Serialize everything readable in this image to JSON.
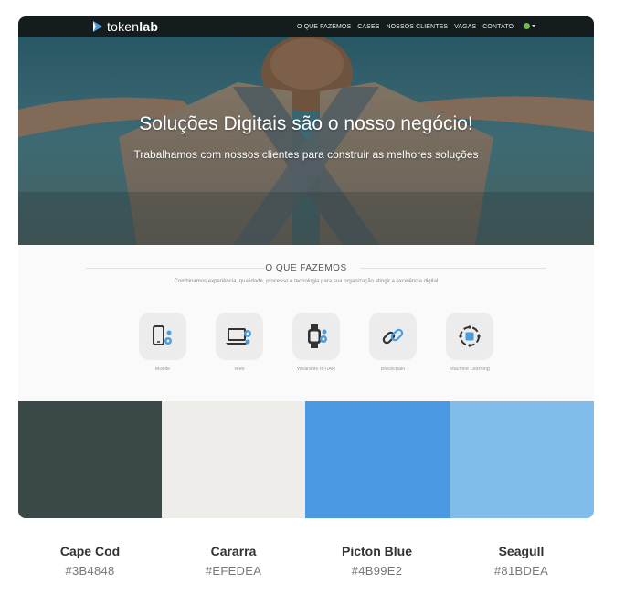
{
  "site": {
    "logo_prefix": "token",
    "logo_suffix": "lab",
    "nav": [
      "O QUE FAZEMOS",
      "CASES",
      "NOSSOS CLIENTES",
      "VAGAS",
      "CONTATO"
    ]
  },
  "hero": {
    "title": "Soluções Digitais são o nosso negócio!",
    "subtitle": "Trabalhamos com nossos clientes para construir as melhores soluções"
  },
  "services": {
    "title": "O QUE FAZEMOS",
    "description": "Combinamos experiência, qualidade, processo e tecnologia para sua organização atingir a excelência digital",
    "items": [
      {
        "label": "Mobile",
        "icon": "mobile-gear-icon"
      },
      {
        "label": "Web",
        "icon": "laptop-gear-icon"
      },
      {
        "label": "Wearable IoT/AR",
        "icon": "smartwatch-gear-icon"
      },
      {
        "label": "Blockchain",
        "icon": "chain-link-icon"
      },
      {
        "label": "Machine Learning",
        "icon": "machine-learning-icon"
      }
    ],
    "accent": "#4a9ee0"
  },
  "palette": [
    {
      "name": "Cape Cod",
      "hex": "#3B4848"
    },
    {
      "name": "Cararra",
      "hex": "#EFEDEA"
    },
    {
      "name": "Picton Blue",
      "hex": "#4B99E2"
    },
    {
      "name": "Seagull",
      "hex": "#81BDEA"
    }
  ]
}
